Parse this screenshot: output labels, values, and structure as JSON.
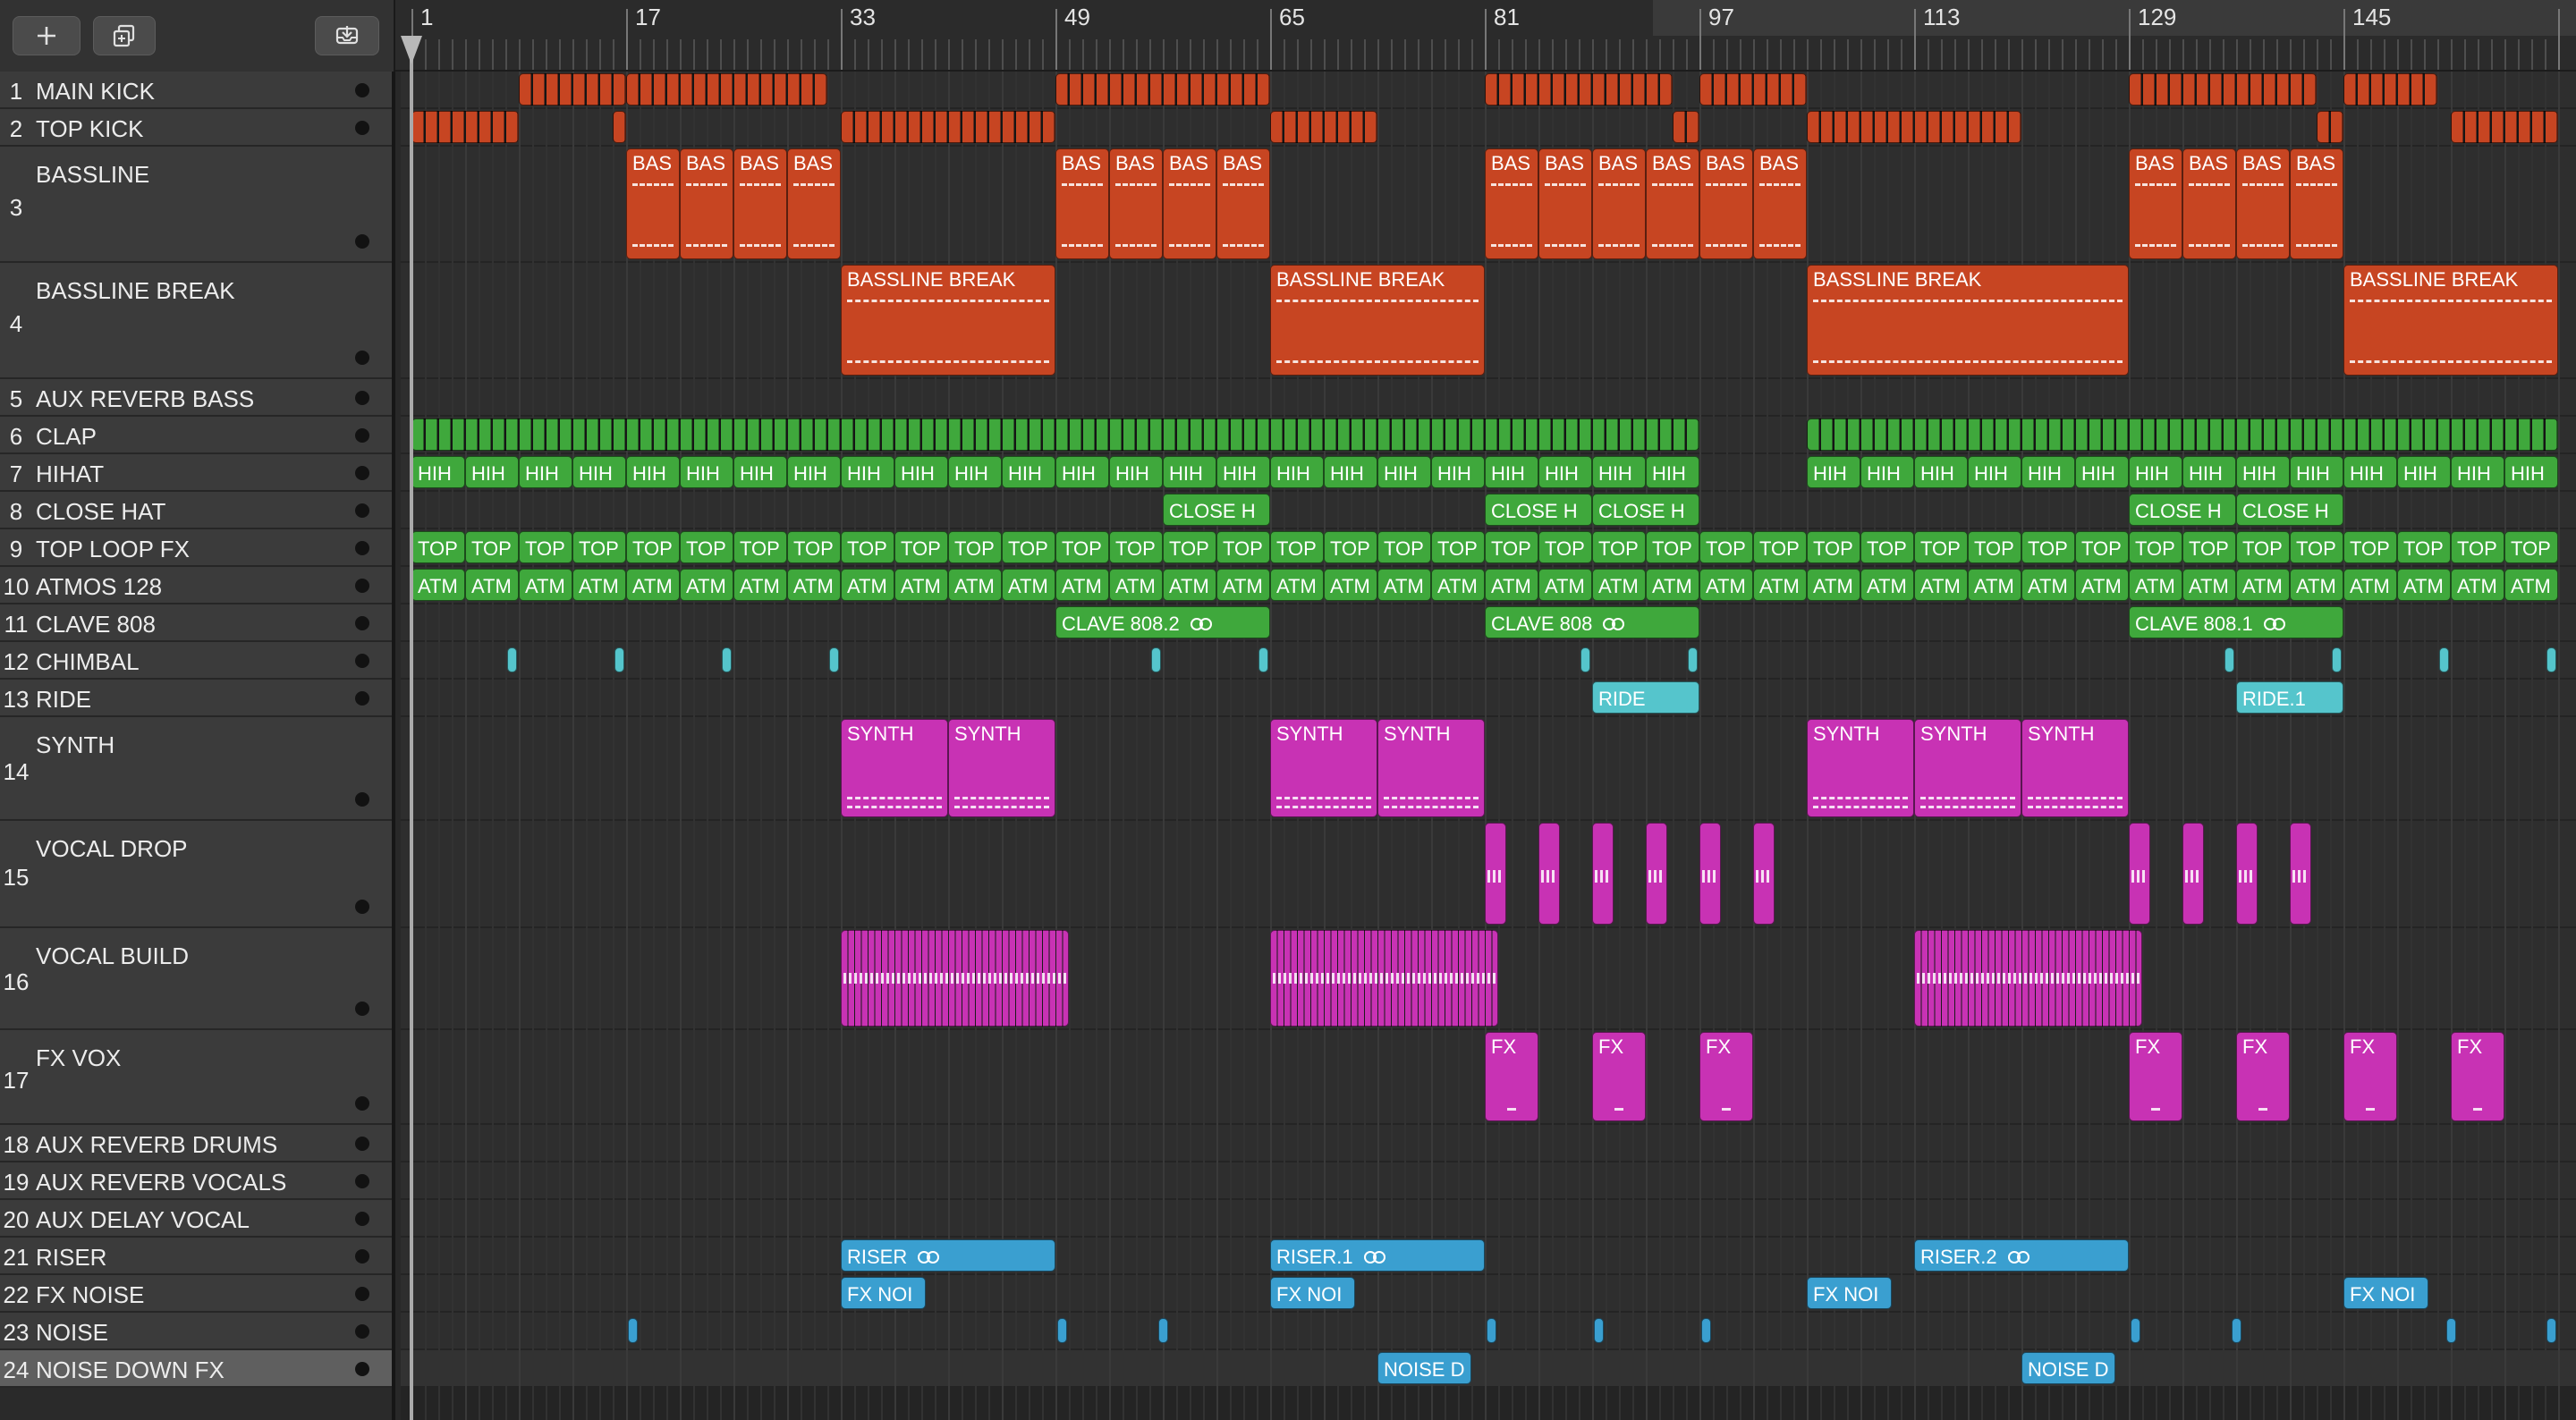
{
  "colors": {
    "red": "#c74522",
    "green": "#3fa83c",
    "cyan": "#55c5cc",
    "magenta": "#c832b4",
    "blue": "#3a9fd0"
  },
  "toolbar": {
    "add_icon": "plus-icon",
    "duplicate_icon": "duplicate-track-icon",
    "download_icon": "tray-download-icon"
  },
  "ruler": {
    "bars": [
      "1",
      "17",
      "33",
      "49",
      "65",
      "81",
      "97",
      "113",
      "129",
      "145"
    ]
  },
  "tracks": [
    {
      "num": "1",
      "name": "MAIN KICK",
      "size": "s"
    },
    {
      "num": "2",
      "name": "TOP KICK",
      "size": "s"
    },
    {
      "num": "3",
      "name": "BASSLINE",
      "size": "m"
    },
    {
      "num": "4",
      "name": "BASSLINE BREAK",
      "size": "m"
    },
    {
      "num": "5",
      "name": "AUX REVERB BASS",
      "size": "s"
    },
    {
      "num": "6",
      "name": "CLAP",
      "size": "s"
    },
    {
      "num": "7",
      "name": "HIHAT",
      "size": "s"
    },
    {
      "num": "8",
      "name": "CLOSE HAT",
      "size": "s"
    },
    {
      "num": "9",
      "name": "TOP LOOP FX",
      "size": "s"
    },
    {
      "num": "10",
      "name": "ATMOS 128",
      "size": "s"
    },
    {
      "num": "11",
      "name": "CLAVE 808",
      "size": "s"
    },
    {
      "num": "12",
      "name": "CHIMBAL",
      "size": "s"
    },
    {
      "num": "13",
      "name": "RIDE",
      "size": "s"
    },
    {
      "num": "14",
      "name": "SYNTH",
      "size": "m"
    },
    {
      "num": "15",
      "name": "VOCAL DROP",
      "size": "m"
    },
    {
      "num": "16",
      "name": "VOCAL BUILD",
      "size": "m"
    },
    {
      "num": "17",
      "name": "FX VOX",
      "size": "m"
    },
    {
      "num": "18",
      "name": "AUX REVERB DRUMS",
      "size": "s"
    },
    {
      "num": "19",
      "name": "AUX REVERB VOCALS",
      "size": "s"
    },
    {
      "num": "20",
      "name": "AUX DELAY VOCAL",
      "size": "s"
    },
    {
      "num": "21",
      "name": "RISER",
      "size": "s"
    },
    {
      "num": "22",
      "name": "FX NOISE",
      "size": "s"
    },
    {
      "num": "23",
      "name": "NOISE",
      "size": "s"
    },
    {
      "num": "24",
      "name": "NOISE DOWN FX",
      "size": "s",
      "selected": true
    }
  ],
  "regions": [
    {
      "t": 0,
      "color": "red",
      "start": 9,
      "end": 17,
      "count": 1,
      "mode": "micro"
    },
    {
      "t": 0,
      "color": "red",
      "start": 17,
      "end": 32,
      "count": 1,
      "mode": "micro"
    },
    {
      "t": 0,
      "color": "red",
      "start": 49,
      "end": 65,
      "count": 1,
      "mode": "micro"
    },
    {
      "t": 0,
      "color": "red",
      "start": 81,
      "end": 95,
      "count": 1,
      "mode": "micro"
    },
    {
      "t": 0,
      "color": "red",
      "start": 97,
      "end": 105,
      "count": 1,
      "mode": "micro"
    },
    {
      "t": 0,
      "color": "red",
      "start": 129,
      "end": 143,
      "count": 1,
      "mode": "micro"
    },
    {
      "t": 0,
      "color": "red",
      "start": 145,
      "end": 152,
      "count": 1,
      "mode": "micro"
    },
    {
      "t": 1,
      "color": "red",
      "start": 1,
      "end": 9,
      "count": 1,
      "mode": "micro"
    },
    {
      "t": 1,
      "color": "red",
      "start": 16,
      "end": 17,
      "count": 1,
      "mode": "micro"
    },
    {
      "t": 1,
      "color": "red",
      "start": 33,
      "end": 49,
      "count": 1,
      "mode": "micro"
    },
    {
      "t": 1,
      "color": "red",
      "start": 65,
      "end": 73,
      "count": 1,
      "mode": "micro"
    },
    {
      "t": 1,
      "color": "red",
      "start": 95,
      "end": 97,
      "count": 1,
      "mode": "micro"
    },
    {
      "t": 1,
      "color": "red",
      "start": 105,
      "end": 121,
      "count": 1,
      "mode": "micro"
    },
    {
      "t": 1,
      "color": "red",
      "start": 143,
      "end": 145,
      "count": 1,
      "mode": "micro"
    },
    {
      "t": 1,
      "color": "red",
      "start": 153,
      "end": 161,
      "count": 1,
      "mode": "micro"
    },
    {
      "t": 2,
      "color": "red",
      "start": 17,
      "end": 33,
      "count": 4,
      "label": "BAS",
      "dash": "both"
    },
    {
      "t": 2,
      "color": "red",
      "start": 49,
      "end": 65,
      "count": 4,
      "label": "BAS",
      "dash": "both"
    },
    {
      "t": 2,
      "color": "red",
      "start": 81,
      "end": 105,
      "count": 6,
      "label": "BAS",
      "dash": "both"
    },
    {
      "t": 2,
      "color": "red",
      "start": 129,
      "end": 145,
      "count": 4,
      "label": "BAS",
      "dash": "both"
    },
    {
      "t": 3,
      "color": "red",
      "start": 33,
      "end": 49,
      "count": 1,
      "label": "BASSLINE BREAK",
      "dash": "both"
    },
    {
      "t": 3,
      "color": "red",
      "start": 65,
      "end": 81,
      "count": 1,
      "label": "BASSLINE BREAK",
      "dash": "both"
    },
    {
      "t": 3,
      "color": "red",
      "start": 105,
      "end": 129,
      "count": 1,
      "label": "BASSLINE BREAK",
      "dash": "both"
    },
    {
      "t": 3,
      "color": "red",
      "start": 145,
      "end": 161,
      "count": 1,
      "label": "BASSLINE BREAK",
      "dash": "both"
    },
    {
      "t": 5,
      "color": "green",
      "start": 1,
      "end": 97,
      "count": 1,
      "mode": "micro"
    },
    {
      "t": 5,
      "color": "green",
      "start": 105,
      "end": 161,
      "count": 1,
      "mode": "micro"
    },
    {
      "t": 6,
      "color": "green",
      "start": 1,
      "end": 97,
      "count": 24,
      "label": "HIH"
    },
    {
      "t": 6,
      "color": "green",
      "start": 105,
      "end": 161,
      "count": 14,
      "label": "HIH"
    },
    {
      "t": 7,
      "color": "green",
      "start": 57,
      "end": 65,
      "count": 1,
      "label": "CLOSE H"
    },
    {
      "t": 7,
      "color": "green",
      "start": 81,
      "end": 97,
      "count": 2,
      "label": "CLOSE H"
    },
    {
      "t": 7,
      "color": "green",
      "start": 129,
      "end": 145,
      "count": 2,
      "label": "CLOSE H"
    },
    {
      "t": 8,
      "color": "green",
      "start": 1,
      "end": 161,
      "count": 40,
      "label": "TOP"
    },
    {
      "t": 9,
      "color": "green",
      "start": 1,
      "end": 161,
      "count": 40,
      "label": "ATM"
    },
    {
      "t": 10,
      "color": "green",
      "start": 49,
      "end": 65,
      "count": 1,
      "label": "CLAVE 808.2",
      "loop": true
    },
    {
      "t": 10,
      "color": "green",
      "start": 81,
      "end": 97,
      "count": 1,
      "label": "CLAVE 808",
      "loop": true
    },
    {
      "t": 10,
      "color": "green",
      "start": 129,
      "end": 145,
      "count": 1,
      "label": "CLAVE 808.1",
      "loop": true
    },
    {
      "t": 11,
      "color": "cyan",
      "start": 8,
      "end": 9,
      "count": 1,
      "mode": "tick"
    },
    {
      "t": 11,
      "color": "cyan",
      "start": 16,
      "end": 17,
      "count": 1,
      "mode": "tick"
    },
    {
      "t": 11,
      "color": "cyan",
      "start": 24,
      "end": 25,
      "count": 1,
      "mode": "tick"
    },
    {
      "t": 11,
      "color": "cyan",
      "start": 32,
      "end": 33,
      "count": 1,
      "mode": "tick"
    },
    {
      "t": 11,
      "color": "cyan",
      "start": 56,
      "end": 57,
      "count": 1,
      "mode": "tick"
    },
    {
      "t": 11,
      "color": "cyan",
      "start": 64,
      "end": 65,
      "count": 1,
      "mode": "tick"
    },
    {
      "t": 11,
      "color": "cyan",
      "start": 88,
      "end": 89,
      "count": 1,
      "mode": "tick"
    },
    {
      "t": 11,
      "color": "cyan",
      "start": 96,
      "end": 97,
      "count": 1,
      "mode": "tick"
    },
    {
      "t": 11,
      "color": "cyan",
      "start": 136,
      "end": 137,
      "count": 1,
      "mode": "tick"
    },
    {
      "t": 11,
      "color": "cyan",
      "start": 144,
      "end": 145,
      "count": 1,
      "mode": "tick"
    },
    {
      "t": 11,
      "color": "cyan",
      "start": 152,
      "end": 153,
      "count": 1,
      "mode": "tick"
    },
    {
      "t": 11,
      "color": "cyan",
      "start": 160,
      "end": 161,
      "count": 1,
      "mode": "tick"
    },
    {
      "t": 12,
      "color": "cyan",
      "start": 89,
      "end": 97,
      "count": 1,
      "label": "RIDE"
    },
    {
      "t": 12,
      "color": "cyan",
      "start": 137,
      "end": 145,
      "count": 1,
      "label": "RIDE.1"
    },
    {
      "t": 13,
      "color": "magenta",
      "start": 33,
      "end": 49,
      "count": 2,
      "label": "SYNTH",
      "dash": "bottom"
    },
    {
      "t": 13,
      "color": "magenta",
      "start": 65,
      "end": 81,
      "count": 2,
      "label": "SYNTH",
      "dash": "bottom"
    },
    {
      "t": 13,
      "color": "magenta",
      "start": 105,
      "end": 129,
      "count": 3,
      "label": "SYNTH",
      "dash": "bottom"
    },
    {
      "t": 14,
      "color": "magenta",
      "start": 81,
      "end": 82.6,
      "count": 1,
      "mode": "pulse"
    },
    {
      "t": 14,
      "color": "magenta",
      "start": 85,
      "end": 86.6,
      "count": 1,
      "mode": "pulse"
    },
    {
      "t": 14,
      "color": "magenta",
      "start": 89,
      "end": 90.6,
      "count": 1,
      "mode": "pulse"
    },
    {
      "t": 14,
      "color": "magenta",
      "start": 93,
      "end": 94.6,
      "count": 1,
      "mode": "pulse"
    },
    {
      "t": 14,
      "color": "magenta",
      "start": 97,
      "end": 98.6,
      "count": 1,
      "mode": "pulse"
    },
    {
      "t": 14,
      "color": "magenta",
      "start": 101,
      "end": 102.6,
      "count": 1,
      "mode": "pulse"
    },
    {
      "t": 14,
      "color": "magenta",
      "start": 129,
      "end": 130.6,
      "count": 1,
      "mode": "pulse"
    },
    {
      "t": 14,
      "color": "magenta",
      "start": 133,
      "end": 134.6,
      "count": 1,
      "mode": "pulse"
    },
    {
      "t": 14,
      "color": "magenta",
      "start": 137,
      "end": 138.6,
      "count": 1,
      "mode": "pulse"
    },
    {
      "t": 14,
      "color": "magenta",
      "start": 141,
      "end": 142.6,
      "count": 1,
      "mode": "pulse"
    },
    {
      "t": 15,
      "color": "magenta",
      "start": 33,
      "end": 50,
      "count": 1,
      "mode": "build"
    },
    {
      "t": 15,
      "color": "magenta",
      "start": 65,
      "end": 82,
      "count": 1,
      "mode": "build"
    },
    {
      "t": 15,
      "color": "magenta",
      "start": 113,
      "end": 130,
      "count": 1,
      "mode": "build"
    },
    {
      "t": 16,
      "color": "magenta",
      "start": 81,
      "end": 85,
      "count": 1,
      "label": "FX"
    },
    {
      "t": 16,
      "color": "magenta",
      "start": 89,
      "end": 93,
      "count": 1,
      "label": "FX"
    },
    {
      "t": 16,
      "color": "magenta",
      "start": 97,
      "end": 101,
      "count": 1,
      "label": "FX"
    },
    {
      "t": 16,
      "color": "magenta",
      "start": 129,
      "end": 133,
      "count": 1,
      "label": "FX"
    },
    {
      "t": 16,
      "color": "magenta",
      "start": 137,
      "end": 141,
      "count": 1,
      "label": "FX"
    },
    {
      "t": 16,
      "color": "magenta",
      "start": 145,
      "end": 149,
      "count": 1,
      "label": "FX"
    },
    {
      "t": 16,
      "color": "magenta",
      "start": 153,
      "end": 157,
      "count": 1,
      "label": "FX"
    },
    {
      "t": 20,
      "color": "blue",
      "start": 33,
      "end": 49,
      "count": 1,
      "label": "RISER",
      "loop": true
    },
    {
      "t": 20,
      "color": "blue",
      "start": 65,
      "end": 81,
      "count": 1,
      "label": "RISER.1",
      "loop": true
    },
    {
      "t": 20,
      "color": "blue",
      "start": 113,
      "end": 129,
      "count": 1,
      "label": "RISER.2",
      "loop": true
    },
    {
      "t": 21,
      "color": "blue",
      "start": 33,
      "end": 39.3,
      "count": 1,
      "label": "FX NOI"
    },
    {
      "t": 21,
      "color": "blue",
      "start": 65,
      "end": 71.3,
      "count": 1,
      "label": "FX NOI"
    },
    {
      "t": 21,
      "color": "blue",
      "start": 105,
      "end": 111.3,
      "count": 1,
      "label": "FX NOI"
    },
    {
      "t": 21,
      "color": "blue",
      "start": 145,
      "end": 151.3,
      "count": 1,
      "label": "FX NOI"
    },
    {
      "t": 22,
      "color": "blue",
      "start": 17,
      "end": 18,
      "count": 1,
      "mode": "tick"
    },
    {
      "t": 22,
      "color": "blue",
      "start": 49,
      "end": 50,
      "count": 1,
      "mode": "tick"
    },
    {
      "t": 22,
      "color": "blue",
      "start": 56.5,
      "end": 57.5,
      "count": 1,
      "mode": "tick"
    },
    {
      "t": 22,
      "color": "blue",
      "start": 81,
      "end": 82,
      "count": 1,
      "mode": "tick"
    },
    {
      "t": 22,
      "color": "blue",
      "start": 89,
      "end": 90,
      "count": 1,
      "mode": "tick"
    },
    {
      "t": 22,
      "color": "blue",
      "start": 97,
      "end": 98,
      "count": 1,
      "mode": "tick"
    },
    {
      "t": 22,
      "color": "blue",
      "start": 129,
      "end": 130,
      "count": 1,
      "mode": "tick"
    },
    {
      "t": 22,
      "color": "blue",
      "start": 136.5,
      "end": 137.5,
      "count": 1,
      "mode": "tick"
    },
    {
      "t": 22,
      "color": "blue",
      "start": 152.5,
      "end": 153.5,
      "count": 1,
      "mode": "tick"
    },
    {
      "t": 22,
      "color": "blue",
      "start": 160,
      "end": 161,
      "count": 1,
      "mode": "tick"
    },
    {
      "t": 23,
      "color": "blue",
      "start": 73,
      "end": 80,
      "count": 1,
      "label": "NOISE D"
    },
    {
      "t": 23,
      "color": "blue",
      "start": 121,
      "end": 128,
      "count": 1,
      "label": "NOISE D"
    }
  ]
}
